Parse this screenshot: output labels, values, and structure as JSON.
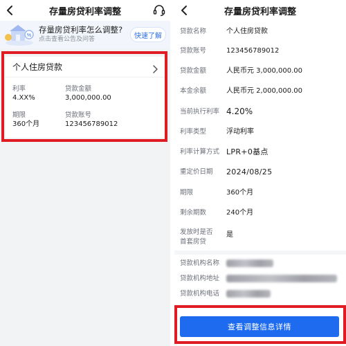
{
  "left": {
    "nav_title": "存量房贷利率调整",
    "banner": {
      "title": "存量房贷利率怎么调整?",
      "subtitle": "点击查看公告及问答",
      "button": "快速了解"
    },
    "loan_card": {
      "title": "个人住房贷款",
      "rate_label": "利率",
      "rate_value": "4.XX%",
      "amount_label": "贷款金额",
      "amount_value": "3,000,000.00",
      "term_label": "期限",
      "term_value": "360个月",
      "account_label": "贷款账号",
      "account_value": "123456789012"
    }
  },
  "right": {
    "nav_title": "存量房贷利率调整",
    "rows": [
      {
        "label": "贷款名称",
        "value": "个人住房贷款"
      },
      {
        "label": "贷款账号",
        "value": "123456789012"
      },
      {
        "label": "贷款金额",
        "value": "人民币元 3,000,000.00"
      },
      {
        "label": "本金余额",
        "value": "人民币元 2,000,000.00"
      },
      {
        "label": "当前执行利率",
        "value": "4.20%"
      },
      {
        "label": "利率类型",
        "value": "浮动利率"
      },
      {
        "label": "利率计算方式",
        "value": "LPR+0基点"
      },
      {
        "label": "重定价日期",
        "value": "2024/08/25"
      },
      {
        "label": "期限",
        "value": "360个月"
      },
      {
        "label": "剩余期数",
        "value": "240个月"
      },
      {
        "label_line1": "发放时是否",
        "label_line2": "首套房贷",
        "value": "是"
      }
    ],
    "institution": [
      {
        "label": "贷款机构名称"
      },
      {
        "label": "贷款机构地址"
      },
      {
        "label": "贷款机构电话"
      }
    ],
    "primary_button": "查看调整信息详情"
  },
  "colors": {
    "accent": "#1e6bf0",
    "highlight": "#e01b24",
    "link": "#2f6fe4"
  }
}
